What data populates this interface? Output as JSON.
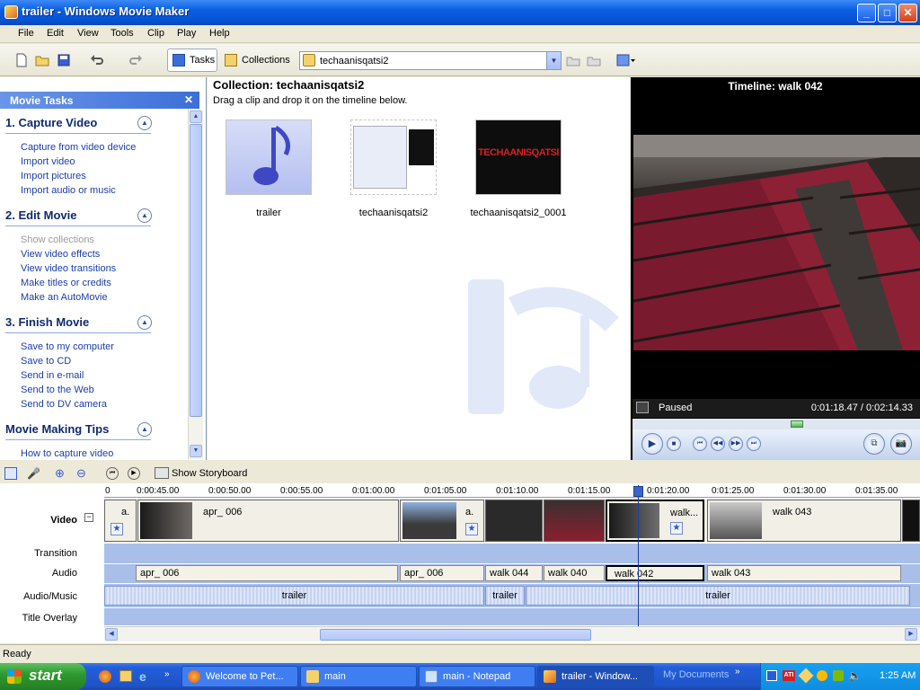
{
  "window": {
    "title": "trailer - Windows Movie Maker",
    "min": "_",
    "max": "□",
    "close": "✕"
  },
  "menu": [
    "File",
    "Edit",
    "View",
    "Tools",
    "Clip",
    "Play",
    "Help"
  ],
  "toolbar": {
    "tasks_label": "Tasks",
    "collections_label": "Collections",
    "collection_value": "techaanisqatsi2"
  },
  "tasks_pane": {
    "header": "Movie Tasks",
    "sections": [
      {
        "title": "1. Capture Video",
        "items": [
          "Capture from video device",
          "Import video",
          "Import pictures",
          "Import audio or music"
        ]
      },
      {
        "title": "2. Edit Movie",
        "items": [
          "Show collections",
          "View video effects",
          "View video transitions",
          "Make titles or credits",
          "Make an AutoMovie"
        ]
      },
      {
        "title": "3. Finish Movie",
        "items": [
          "Save to my computer",
          "Save to CD",
          "Send in e-mail",
          "Send to the Web",
          "Send to DV camera"
        ]
      },
      {
        "title": "Movie Making Tips",
        "items": [
          "How to capture video"
        ]
      }
    ]
  },
  "collection": {
    "title": "Collection: techaanisqatsi2",
    "subtitle": "Drag a clip and drop it on the timeline below.",
    "clips": [
      "trailer",
      "techaanisqatsi2",
      "techaanisqatsi2_0001"
    ],
    "thumb_text": "TECHAANISQATSI"
  },
  "preview": {
    "title": "Timeline: walk 042",
    "status": "Paused",
    "time": "0:01:18.47 / 0:02:14.33"
  },
  "timeline": {
    "storyboard_label": "Show Storyboard",
    "ruler": [
      "0",
      "0:00:45.00",
      "0:00:50.00",
      "0:00:55.00",
      "0:01:00.00",
      "0:01:05.00",
      "0:01:10.00",
      "0:01:15.00",
      "0:01:20.00",
      "0:01:25.00",
      "0:01:30.00",
      "0:01:35.00"
    ],
    "tracks": [
      "Video",
      "Transition",
      "Audio",
      "Audio/Music",
      "Title Overlay"
    ],
    "video_clips": [
      "a.",
      "apr_ 006",
      "a.",
      "walk...",
      "walk 043"
    ],
    "audio_clips": [
      "apr_ 006",
      "apr_ 006",
      "walk 044",
      "walk 040",
      "walk 042",
      "walk 043"
    ],
    "music_clips": [
      "trailer",
      "trailer",
      "trailer"
    ]
  },
  "status": "Ready",
  "taskbar": {
    "start": "start",
    "items": [
      "Welcome to Pet...",
      "main",
      "main - Notepad",
      "trailer - Window...",
      "My Documents"
    ],
    "clock": "1:25 AM"
  }
}
